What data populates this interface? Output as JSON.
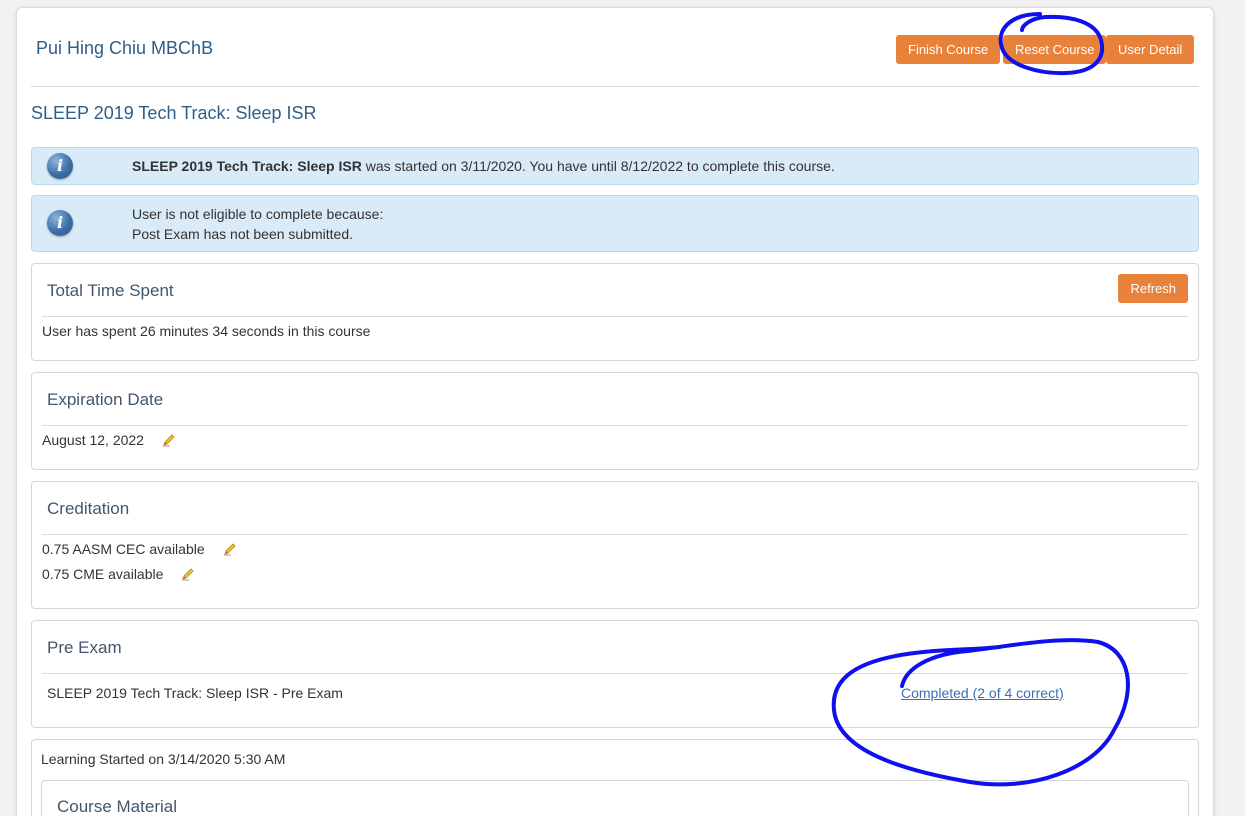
{
  "header": {
    "user_name": "Pui Hing Chiu MBChB",
    "buttons": {
      "finish": "Finish Course",
      "reset": "Reset Course",
      "user_detail": "User Detail"
    }
  },
  "course": {
    "title": "SLEEP 2019 Tech Track: Sleep ISR"
  },
  "alerts": {
    "started": {
      "course_name": "SLEEP 2019 Tech Track: Sleep ISR",
      "text": " was started on 3/11/2020. You have until 8/12/2022 to complete this course."
    },
    "eligibility": {
      "line1": "User is not eligible to complete because:",
      "line2": "Post Exam has not been submitted."
    }
  },
  "time_spent": {
    "title": "Total Time Spent",
    "refresh_label": "Refresh",
    "text": "User has spent 26 minutes 34 seconds in this course"
  },
  "expiration": {
    "title": "Expiration Date",
    "date": "August 12, 2022"
  },
  "creditation": {
    "title": "Creditation",
    "items": [
      "0.75 AASM CEC available",
      "0.75 CME available"
    ]
  },
  "pre_exam": {
    "title": "Pre Exam",
    "exam_name": "SLEEP 2019 Tech Track: Sleep ISR - Pre Exam",
    "status_link": "Completed (2 of 4 correct)"
  },
  "learning": {
    "started_text": "Learning Started on 3/14/2020 5:30 AM",
    "course_material_title": "Course Material"
  },
  "colors": {
    "accent_button": "#e8813a",
    "heading_blue": "#2e5e8c",
    "alert_bg": "#d9ebf6",
    "annotation": "#1010ee"
  },
  "icons": [
    "info-icon",
    "pencil-icon"
  ]
}
